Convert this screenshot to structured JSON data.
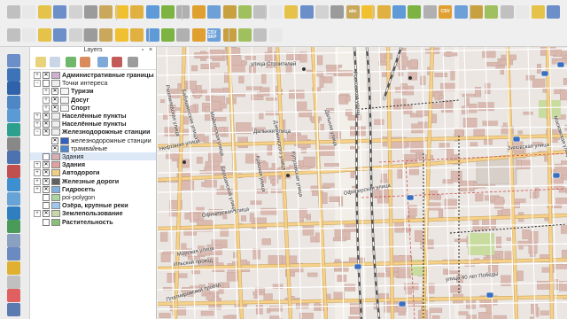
{
  "panel": {
    "title": "Layers",
    "close_icon": "×",
    "float_icon": "▫"
  },
  "layers": [
    {
      "label": "Административные границы",
      "bold": true,
      "level": 0,
      "expand": "+",
      "checked": true,
      "sym": "#d0b0d0"
    },
    {
      "label": "Точки интереса",
      "bold": false,
      "level": 0,
      "expand": "−",
      "checked": false,
      "sym": "#eeeeee"
    },
    {
      "label": "Туризм",
      "bold": true,
      "level": 1,
      "expand": "+",
      "checked": true,
      "sym": "#f5f5f5"
    },
    {
      "label": "Досуг",
      "bold": true,
      "level": 1,
      "expand": "+",
      "checked": true,
      "sym": "#f5f5f5"
    },
    {
      "label": "Спорт",
      "bold": true,
      "level": 1,
      "expand": "+",
      "checked": true,
      "sym": "#f5f5f5"
    },
    {
      "label": "Населённые пункты",
      "bold": true,
      "level": 0,
      "expand": "+",
      "checked": true,
      "sym": "#eeeeee"
    },
    {
      "label": "Населённые пункты",
      "bold": true,
      "level": 0,
      "expand": "+",
      "checked": true,
      "sym": "#eeeeee"
    },
    {
      "label": "Железнодорожные станции",
      "bold": true,
      "level": 0,
      "expand": "−",
      "checked": true,
      "sym": "#eeeeee"
    },
    {
      "label": "железнодорожные станции",
      "bold": false,
      "level": 1,
      "expand": "",
      "checked": true,
      "sym": "#3060c0"
    },
    {
      "label": "трамвайные",
      "bold": false,
      "level": 1,
      "expand": "",
      "checked": true,
      "sym": "#4a88d0"
    },
    {
      "label": "Здания",
      "bold": false,
      "level": 0,
      "expand": "",
      "checked": false,
      "sym": "#d9b0b0",
      "selected": true
    },
    {
      "label": "Здания",
      "bold": true,
      "level": 0,
      "expand": "+",
      "checked": true,
      "sym": "#e0a0a0"
    },
    {
      "label": "Автодороги",
      "bold": true,
      "level": 0,
      "expand": "+",
      "checked": true,
      "sym": "#f0d080"
    },
    {
      "label": "Железные дороги",
      "bold": true,
      "level": 0,
      "expand": "+",
      "checked": true,
      "sym": "#606060"
    },
    {
      "label": "Гидросеть",
      "bold": true,
      "level": 0,
      "expand": "+",
      "checked": true,
      "sym": "#80b0e0"
    },
    {
      "label": "poi-polygon",
      "bold": false,
      "level": 0,
      "expand": "",
      "checked": false,
      "sym": "#a8d8a0"
    },
    {
      "label": "Озёра, крупные реки",
      "bold": true,
      "level": 0,
      "expand": "",
      "checked": false,
      "sym": "#9ec7ef"
    },
    {
      "label": "Землепользование",
      "bold": true,
      "level": 0,
      "expand": "+",
      "checked": true,
      "sym": "#c8d8a8"
    },
    {
      "label": "Растительность",
      "bold": true,
      "level": 0,
      "expand": "",
      "checked": false,
      "sym": "#88c078"
    }
  ],
  "streets": [
    {
      "text": "Дальняя улица",
      "rot": 0
    },
    {
      "text": "Офицерская улица",
      "rot": -10
    },
    {
      "text": "Офицерская улица",
      "rot": -8
    },
    {
      "text": "Нефтяная улица",
      "rot": -12
    },
    {
      "text": "Ильский проезд",
      "rot": -6
    },
    {
      "text": "Морская улица",
      "rot": -10
    },
    {
      "text": "Платнировский проезд",
      "rot": -16
    },
    {
      "text": "улица 40 лет Победы",
      "rot": -6
    },
    {
      "text": "Зиповская улица",
      "rot": -5
    },
    {
      "text": "Московская улица",
      "rot": 72
    },
    {
      "text": "Ростовская улица",
      "rot": 85
    },
    {
      "text": "Рашпилевская улица",
      "rot": 78
    },
    {
      "text": "Дальняя улица",
      "rot": 76
    },
    {
      "text": "Кутузовская улица",
      "rot": 80
    },
    {
      "text": "Красная улица",
      "rot": 80
    },
    {
      "text": "Бершанской улица",
      "rot": 74
    },
    {
      "text": "улица Строителей",
      "rot": 0
    },
    {
      "text": "Дзержинского улица",
      "rot": 80
    },
    {
      "text": "Майкопская улица",
      "rot": 76
    },
    {
      "text": "Бабушкинская улица",
      "rot": 75
    }
  ],
  "toolbar1_icons": [
    "select-icon",
    "file-icon",
    "open-icon",
    "save-icon",
    "save-as-icon",
    "print-icon",
    "layout-icon",
    "pan-icon",
    "pan-to-icon",
    "zoom-in-icon",
    "zoom-out-icon",
    "zoom-full-icon",
    "zoom-layer-icon",
    "zoom-select-icon",
    "zoom-last-icon",
    "zoom-next-icon",
    "grid-icon",
    "bookmark-icon",
    "identify-icon",
    "measure-icon",
    "sum-icon",
    "attribute-table-icon",
    "label-tool-icon",
    "label-pin-icon",
    "label-rotate-icon",
    "label-move-icon",
    "label-change-icon",
    "label-show-icon",
    "csv-icon",
    "browse-icon",
    "python-icon",
    "help-icon",
    "edit-pen-icon",
    "edit-pencil-icon",
    "digitize-icon",
    "node-tool-icon"
  ],
  "toolbar1_texts": {
    "abc": "abc",
    "csv": "CSV"
  },
  "toolbar2_icons": [
    "new-layer-icon",
    "new-shapefile-icon",
    "new-spatialite-icon",
    "new-gpx-icon",
    "virtual-layer-icon",
    "add-vector-icon",
    "add-raster-icon",
    "add-postgis-icon",
    "add-wms-icon",
    "add-wfs-icon",
    "add-wcs-icon",
    "add-delimited-icon",
    "add-oracle-icon",
    "csv-skp-icon",
    "georef-icon",
    "binoculars-icon",
    "qr-icon",
    "grid-plugin-icon"
  ],
  "toolbar2_texts": {
    "csv_skp": "CSV SKP"
  },
  "left_icons": [
    "vertex-add-icon",
    "point-layer-icon",
    "line-layer-icon",
    "polygon-layer-icon",
    "spatialite-icon",
    "postgis-icon",
    "mssql-icon",
    "db2-icon",
    "oracle-icon",
    "wms-icon",
    "wcs-icon",
    "wfs-icon",
    "delimited-text-icon",
    "gps-icon",
    "virtual-icon",
    "edit-icon",
    "paste-icon",
    "deselect-icon",
    "digitize-poly-icon"
  ],
  "colors": {
    "background": "#f2efe9",
    "road_major": "#f7d08a",
    "road_minor": "#ffffff",
    "building": "#d9b9b0",
    "residential": "#e6dedc",
    "rail": "#555555",
    "park": "#c8dca0"
  }
}
